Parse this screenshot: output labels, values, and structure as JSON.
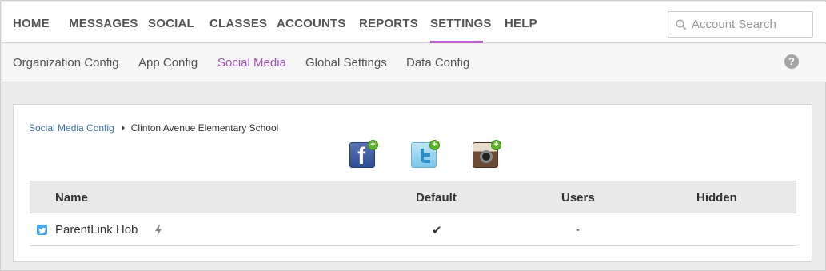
{
  "topnav": {
    "items": [
      {
        "label": "HOME"
      },
      {
        "label": "MESSAGES"
      },
      {
        "label": "SOCIAL"
      },
      {
        "label": "CLASSES"
      },
      {
        "label": "ACCOUNTS"
      },
      {
        "label": "REPORTS"
      },
      {
        "label": "SETTINGS",
        "active": true
      },
      {
        "label": "HELP"
      }
    ],
    "search_placeholder": "Account Search",
    "accent_color": "#b55fc9"
  },
  "subnav": {
    "items": [
      {
        "label": "Organization Config"
      },
      {
        "label": "App Config"
      },
      {
        "label": "Social Media",
        "active": true
      },
      {
        "label": "Global Settings"
      },
      {
        "label": "Data Config"
      }
    ],
    "help_icon": "question-circle-icon"
  },
  "breadcrumb": {
    "parent": "Social Media Config",
    "current": "Clinton Avenue Elementary School"
  },
  "social_buttons": [
    {
      "icon": "facebook-add-icon"
    },
    {
      "icon": "twitter-add-icon"
    },
    {
      "icon": "instagram-add-icon"
    }
  ],
  "table": {
    "columns": [
      "Name",
      "Default",
      "Users",
      "Hidden"
    ],
    "rows": [
      {
        "name": "ParentLink Hob",
        "default": "✔",
        "users": "-",
        "hidden": ""
      }
    ]
  }
}
